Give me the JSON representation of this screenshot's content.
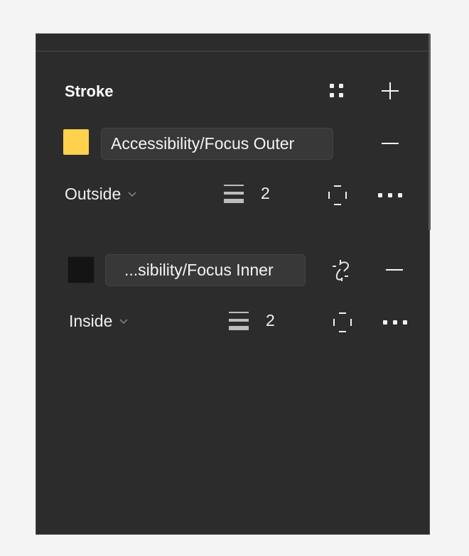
{
  "panel": {
    "title": "Stroke"
  },
  "strokes": [
    {
      "color": "#ffd24d",
      "style_name": "Accessibility/Focus Outer",
      "position": "Outside",
      "weight": "2"
    },
    {
      "color": "#141414",
      "style_name": "...sibility/Focus Inner",
      "position": "Inside",
      "weight": "2"
    }
  ],
  "icons": {
    "styles": "styles-grid-icon",
    "add": "plus-icon",
    "remove": "minus-icon",
    "weight": "stroke-weight-icon",
    "per_side": "individual-strokes-icon",
    "more": "more-icon",
    "detach": "detach-style-icon",
    "dropdown": "chevron-down-icon"
  }
}
